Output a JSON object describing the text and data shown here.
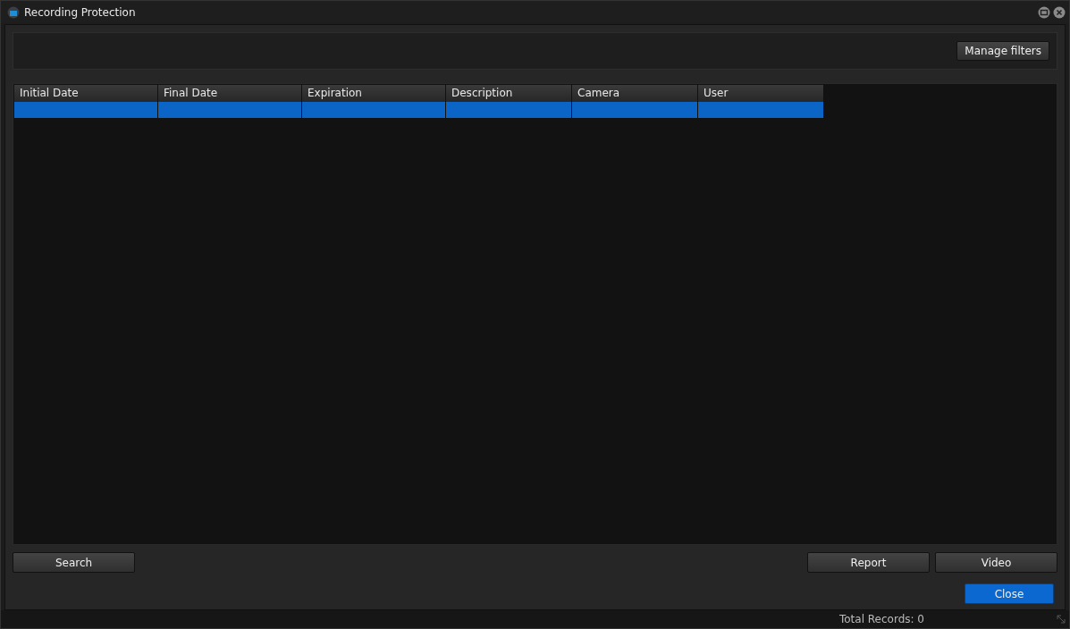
{
  "window": {
    "title": "Recording Protection"
  },
  "filters": {
    "button": "Manage filters"
  },
  "table": {
    "columns": [
      "Initial Date",
      "Final Date",
      "Expiration",
      "Description",
      "Camera",
      "User"
    ],
    "rows": [
      {
        "selected": true
      }
    ]
  },
  "actions": {
    "left": [
      "Search"
    ],
    "right": [
      "Report",
      "Video"
    ]
  },
  "close_button": "Close",
  "status_bar": {
    "text": "Total Records: 0"
  }
}
